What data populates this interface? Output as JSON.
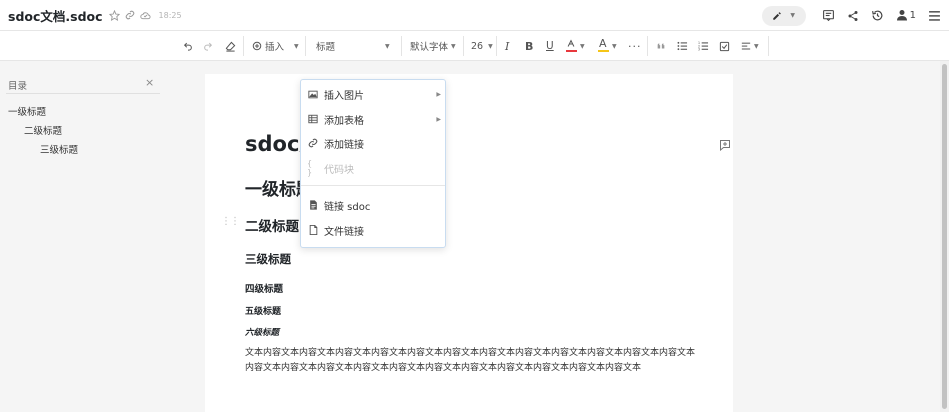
{
  "header": {
    "title": "sdoc文档.sdoc",
    "save_time": "18:25",
    "user_count": "1"
  },
  "toolbar": {
    "insert_label": "插入",
    "style_label": "标题",
    "font_label": "默认字体",
    "size_label": "26"
  },
  "sidebar": {
    "title": "目录",
    "close": "×",
    "items": [
      {
        "label": "一级标题"
      },
      {
        "label": "二级标题"
      },
      {
        "label": "三级标题"
      }
    ]
  },
  "document": {
    "title": "sdoc文",
    "h1": "一级标题",
    "h2": "二级标题",
    "h3": "三级标题",
    "h4": "四级标题",
    "h5": "五级标题",
    "h6": "六级标题",
    "paragraph": "文本内容文本内容文本内容文本内容文本内容文本内容文本内容文本内容文本内容文本内容文本内容文本内容文本内容文本内容文本内容文本内容文本内容文本内容文本内容文本内容文本内容文本内容文本内容文本"
  },
  "menu": {
    "items": [
      {
        "label": "插入图片"
      },
      {
        "label": "添加表格"
      },
      {
        "label": "添加链接"
      },
      {
        "label": "代码块"
      },
      {
        "label": "链接 sdoc"
      },
      {
        "label": "文件链接"
      }
    ]
  },
  "colors": {
    "font_color_bar": "#e8383d",
    "highlight_bar": "#f5c518",
    "menu_border": "#c8dcf0"
  }
}
